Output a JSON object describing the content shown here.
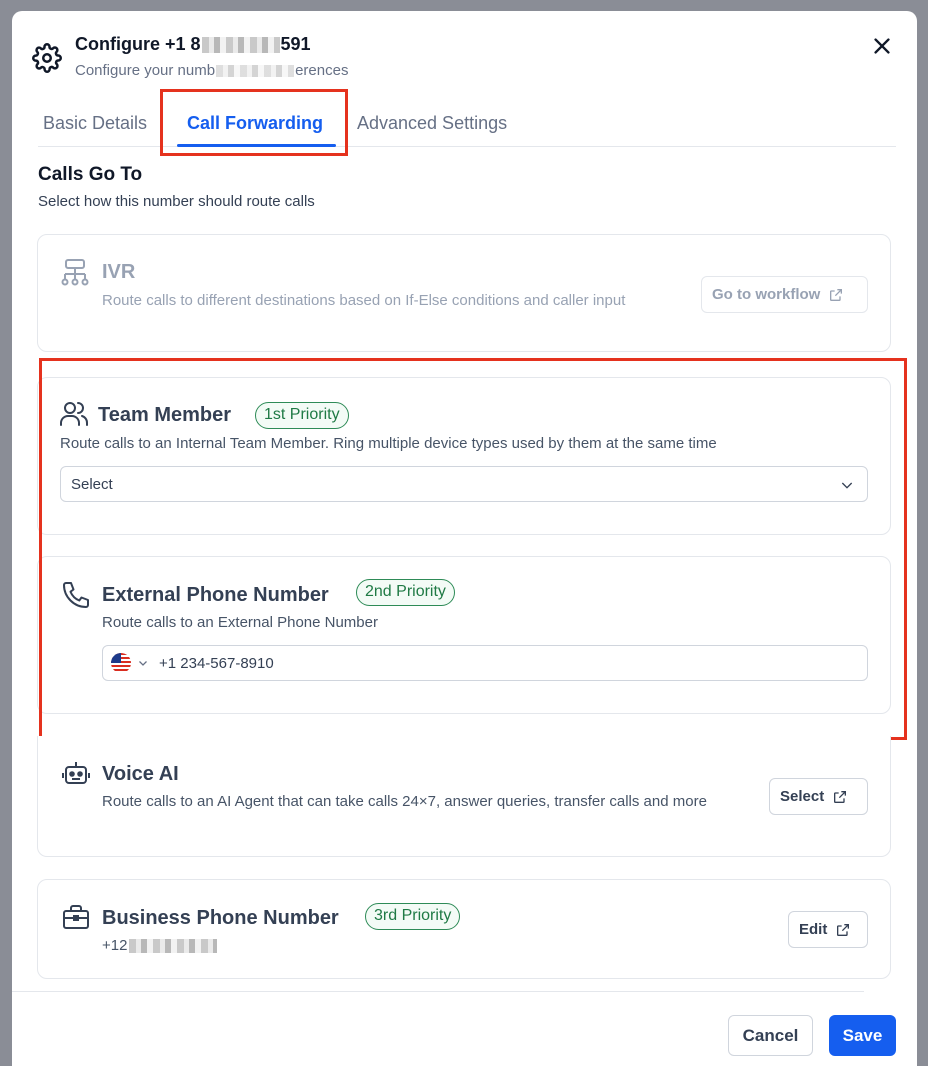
{
  "header": {
    "title_prefix": "Configure +1 8",
    "title_suffix": "591",
    "subtitle_prefix": "Configure your numb",
    "subtitle_suffix": "erences"
  },
  "tabs": [
    {
      "label": "Basic Details",
      "active": false
    },
    {
      "label": "Call Forwarding",
      "active": true
    },
    {
      "label": "Advanced Settings",
      "active": false
    }
  ],
  "section": {
    "title": "Calls Go To",
    "subtitle": "Select how this number should route calls"
  },
  "ivr": {
    "title": "IVR",
    "description": "Route calls to different destinations based on If-Else conditions and caller input",
    "button": "Go to workflow"
  },
  "team_member": {
    "title": "Team Member",
    "badge": "1st Priority",
    "description": "Route calls to an Internal Team Member. Ring multiple device types used by them at the same time",
    "select_placeholder": "Select"
  },
  "external": {
    "title": "External Phone Number",
    "badge": "2nd Priority",
    "description": "Route calls to an External Phone Number",
    "phone_value": "+1 234-567-8910"
  },
  "voice_ai": {
    "title": "Voice AI",
    "description": "Route calls to an AI Agent that can take calls 24×7, answer queries, transfer calls and more",
    "button": "Select"
  },
  "business": {
    "title": "Business Phone Number",
    "badge": "3rd Priority",
    "number_prefix": "+12",
    "button": "Edit"
  },
  "footer": {
    "cancel": "Cancel",
    "save": "Save"
  },
  "colors": {
    "primary": "#155eef",
    "highlight": "#e5321e",
    "badge_green": "#2e8b57"
  }
}
